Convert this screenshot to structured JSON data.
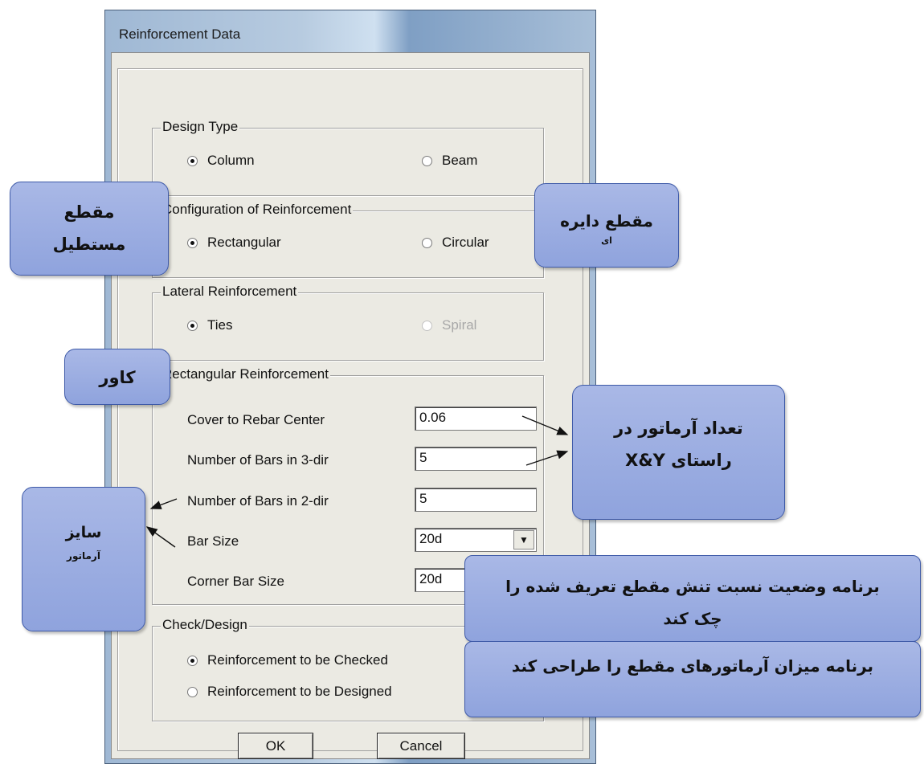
{
  "window": {
    "title": "Reinforcement Data"
  },
  "design_type": {
    "legend": "Design Type",
    "options": [
      {
        "label": "Column",
        "selected": true
      },
      {
        "label": "Beam",
        "selected": false
      }
    ]
  },
  "configuration": {
    "legend": "Configuration of Reinforcement",
    "options": [
      {
        "label": "Rectangular",
        "selected": true
      },
      {
        "label": "Circular",
        "selected": false
      }
    ]
  },
  "lateral": {
    "legend": "Lateral Reinforcement",
    "options": [
      {
        "label": "Ties",
        "selected": true
      },
      {
        "label": "Spiral",
        "selected": false,
        "disabled": true
      }
    ]
  },
  "rectangular": {
    "legend": "Rectangular Reinforcement",
    "cover_label": "Cover to Rebar Center",
    "cover_value": "0.06",
    "bars3_label": "Number of Bars in 3-dir",
    "bars3_value": "5",
    "bars2_label": "Number of Bars in 2-dir",
    "bars2_value": "5",
    "bar_size_label": "Bar Size",
    "bar_size_value": "20d",
    "corner_label": "Corner Bar Size",
    "corner_value": "20d"
  },
  "check_design": {
    "legend": "Check/Design",
    "options": [
      {
        "label": "Reinforcement to be Checked",
        "selected": true
      },
      {
        "label": "Reinforcement to be Designed",
        "selected": false
      }
    ]
  },
  "buttons": {
    "ok": "OK",
    "cancel": "Cancel"
  },
  "callouts": {
    "rect_section": [
      "مقطع",
      "مستطیل"
    ],
    "circ_section": [
      "مقطع دایره",
      "ای"
    ],
    "cover": "کاور",
    "bar_count": [
      "تعداد آرماتور در",
      "راستای X&Y"
    ],
    "bar_size": [
      "سایز",
      "آرماتور"
    ],
    "check": [
      "برنامه وضعیت نسبت تنش مقطع تعریف شده را",
      "چک کند"
    ],
    "design": "برنامه میزان آرماتورهای مقطع را طراحی کند"
  },
  "colors": {
    "callout_fill": "#98aadf",
    "callout_border": "#3e5aa8",
    "dialog_bg": "#ebeae3"
  },
  "icons": {
    "combo_arrow": "chevron-down-icon",
    "radio": "radio-icon"
  }
}
